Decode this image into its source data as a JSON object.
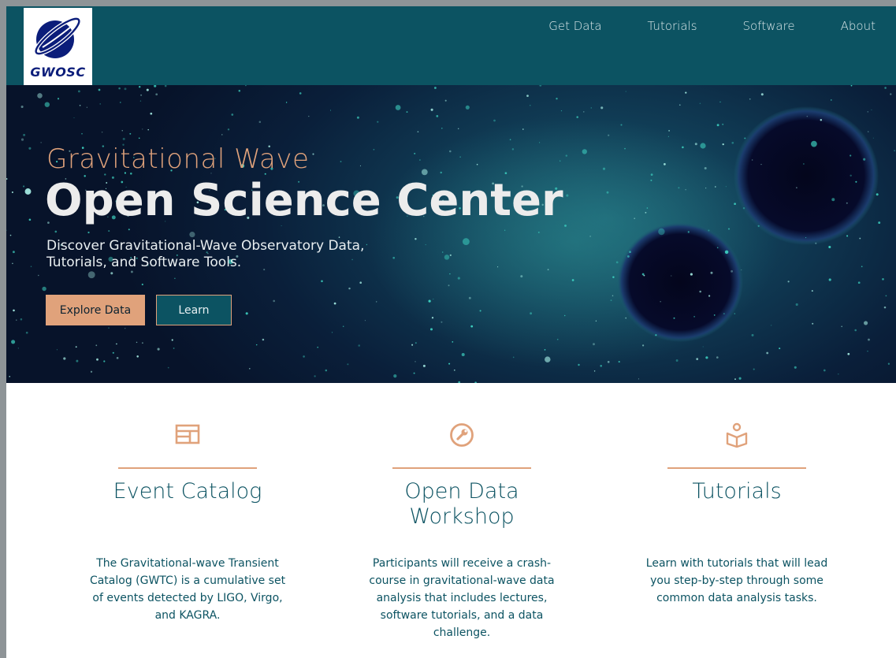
{
  "header": {
    "logo_text": "GWOSC",
    "nav": [
      {
        "label": "Get Data"
      },
      {
        "label": "Tutorials"
      },
      {
        "label": "Software"
      },
      {
        "label": "About"
      }
    ]
  },
  "hero": {
    "subtitle": "Gravitational Wave",
    "title": "Open Science Center",
    "description": "Discover Gravitational-Wave Observatory Data, Tutorials, and Software Tools.",
    "primary_button": "Explore Data",
    "secondary_button": "Learn"
  },
  "features": [
    {
      "icon": "catalog-icon",
      "title": "Event Catalog",
      "description": "The Gravitational-wave Transient Catalog (GWTC) is a cumulative set of events detected by LIGO, Virgo, and KAGRA."
    },
    {
      "icon": "wrench-icon",
      "title": "Open Data Workshop",
      "description": "Participants will receive a crash-course in gravitational-wave data analysis that includes lectures, software tutorials, and a data challenge."
    },
    {
      "icon": "book-person-icon",
      "title": "Tutorials",
      "description": "Learn with tutorials that will lead you step-by-step through some common data analysis tasks."
    }
  ],
  "colors": {
    "header_bg": "#0c5362",
    "accent": "#e0a27b",
    "text_teal": "#0c5362",
    "logo_blue": "#0b1d7a"
  }
}
